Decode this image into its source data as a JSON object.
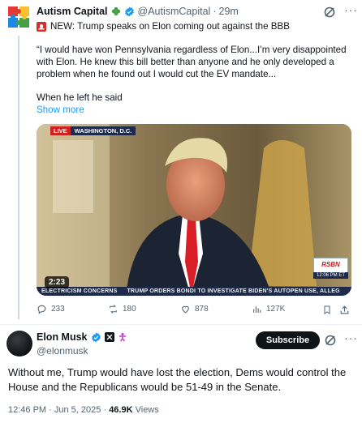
{
  "parent_tweet": {
    "author_name": "Autism Capital",
    "handle": "@AutismCapital",
    "separator": "·",
    "time": "29m",
    "headline": "NEW: Trump speaks on Elon coming out against the BBB",
    "quote": "“I would have won Pennsylvania regardless of Elon...I’m very disappointed with Elon. He knew this bill better than anyone and he only developed a problem when he found out I would cut the EV mandate...",
    "quote_tail": "When he left he said",
    "show_more": "Show more",
    "icons": {
      "avatar": "puzzle-avatar-icon",
      "badge_1": "clover-icon",
      "badge_2": "verified-icon",
      "headline_prefix": "siren-icon",
      "grok": "grok-icon",
      "more": "more-icon"
    },
    "video": {
      "live_label": "LIVE",
      "location": "WASHINGTON, D.C.",
      "network": "RSBN",
      "clock": "12:06 PM ET",
      "ticker_left": "ELECTRICISM CONCERNS",
      "ticker_right": "TRUMP ORDERS BONDI TO INVESTIGATE BIDEN'S AUTOPEN USE, ALLEG",
      "duration": "2:23"
    },
    "actions": {
      "replies": "233",
      "reposts": "180",
      "likes": "878",
      "views": "127K"
    }
  },
  "main_tweet": {
    "author_name": "Elon Musk",
    "handle": "@elonmusk",
    "subscribe_label": "Subscribe",
    "text": "Without me, Trump would have lost the election, Dems would control the House and the Republicans would be 51-49 in the Senate.",
    "time": "12:46 PM",
    "date": "Jun 5, 2025",
    "separator": "·",
    "views_count": "46.9K",
    "views_label": "Views",
    "icons": {
      "avatar": "avatar",
      "verified": "verified-icon",
      "affiliate": "x-badge-icon",
      "extra": "accessibility-icon"
    }
  },
  "colors": {
    "accent_blue": "#1d9bf0",
    "text_primary": "#0f1419",
    "text_secondary": "#536471",
    "divider": "#eff3f4"
  }
}
